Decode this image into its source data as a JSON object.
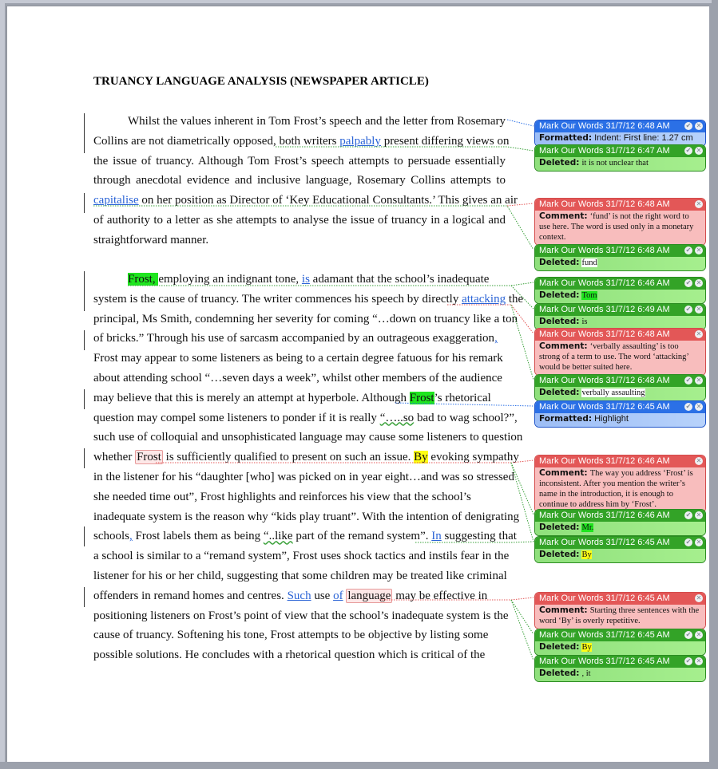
{
  "document": {
    "title": "TRUANCY LANGUAGE ANALYSIS (NEWSPAPER ARTICLE)",
    "paragraph1": [
      {
        "segments": [
          {
            "t": "Whilst the values inherent in Tom Frost’s speech and the letter from Rosemary"
          }
        ]
      },
      {
        "segments": [
          {
            "t": "Collins are not diametrically opposed, both writers "
          },
          {
            "t": "palpably",
            "s": "ins"
          },
          {
            "t": " present differing views on"
          }
        ]
      },
      {
        "segments": [
          {
            "t": "the issue of truancy. Although Tom Frost’s speech attempts to persuade essentially"
          }
        ]
      },
      {
        "segments": [
          {
            "t": "through anecdotal evidence and inclusive language, Rosemary Collins attempts to"
          }
        ]
      },
      {
        "segments": [
          {
            "t": "capitalise",
            "s": "ins"
          },
          {
            "t": " on her position as Director of ‘Key Educational Consultants.’ This gives an air"
          }
        ]
      },
      {
        "segments": [
          {
            "t": "of authority to a letter as she attempts to analyse the issue of truancy in a logical and"
          }
        ]
      },
      {
        "segments": [
          {
            "t": "straightforward manner."
          }
        ]
      }
    ],
    "paragraph2": [
      {
        "segments": [
          {
            "t": "Frost",
            "s": "hl-green"
          },
          {
            "t": ", ",
            "s": "hl-green"
          },
          {
            "t": "employing an indignant tone, "
          },
          {
            "t": "is",
            "s": "ins"
          },
          {
            "t": " adamant that the school’s inadequate"
          }
        ]
      },
      {
        "segments": [
          {
            "t": "system is the cause of truancy. The writer commences his speech by directly "
          },
          {
            "t": "attacking",
            "s": "ins"
          },
          {
            "t": " the"
          }
        ]
      },
      {
        "segments": [
          {
            "t": "principal, Ms Smith, condemning her severity for coming “…down on truancy like a ton"
          }
        ]
      },
      {
        "segments": [
          {
            "t": "of bricks.” Through his use of sarcasm accompanied by an outrageous exaggeration"
          },
          {
            "t": ",",
            "s": "ins"
          }
        ]
      },
      {
        "segments": [
          {
            "t": "Frost may appear to some listeners as being to a certain degree fatuous for his remark"
          }
        ]
      },
      {
        "segments": [
          {
            "t": "about attending school “…seven days a week”, whilst other members of the audience"
          }
        ]
      },
      {
        "segments": [
          {
            "t": "may believe that this is merely an attempt at hyperbole. Although "
          },
          {
            "t": "Frost",
            "s": "hl-green"
          },
          {
            "t": "’s rhetorical"
          }
        ]
      },
      {
        "segments": [
          {
            "t": "question may compel some listeners to ponder if it is really "
          },
          {
            "t": "“…..so",
            "s": "squig"
          },
          {
            "t": " bad to wag school?”,"
          }
        ]
      },
      {
        "segments": [
          {
            "t": "such use of colloquial and unsophisticated language may cause some listeners to question"
          }
        ]
      },
      {
        "segments": [
          {
            "t": "whether "
          },
          {
            "t": "Frost",
            "s": "del-box"
          },
          {
            "t": " is sufficiently qualified to present on such an issue. "
          },
          {
            "t": "By",
            "s": "hl-yellow"
          },
          {
            "t": " evoking sympathy"
          }
        ]
      },
      {
        "segments": [
          {
            "t": "in the listener for his “daughter [who] was picked on in year eight…and was so stressed"
          }
        ]
      },
      {
        "segments": [
          {
            "t": "she needed time out”, Frost highlights and reinforces his view that the school’s"
          }
        ]
      },
      {
        "segments": [
          {
            "t": "inadequate system is the reason why “kids play truant”. With the intention of denigrating"
          }
        ]
      },
      {
        "segments": [
          {
            "t": "schools"
          },
          {
            "t": ",",
            "s": "ins"
          },
          {
            "t": " Frost labels them as being "
          },
          {
            "t": "“..like",
            "s": "squig"
          },
          {
            "t": " part of the remand system”. "
          },
          {
            "t": "In",
            "s": "ins"
          },
          {
            "t": " suggesting that"
          }
        ]
      },
      {
        "segments": [
          {
            "t": "a school is similar to a “remand system”, Frost uses shock tactics and instils fear in the"
          }
        ]
      },
      {
        "segments": [
          {
            "t": "listener for his or her child, suggesting that some children may be treated like criminal"
          }
        ]
      },
      {
        "segments": [
          {
            "t": "offenders in remand homes and centres. "
          },
          {
            "t": "Such",
            "s": "ins"
          },
          {
            "t": " use "
          },
          {
            "t": "of",
            "s": "ins"
          },
          {
            "t": " "
          },
          {
            "t": "language",
            "s": "del-box"
          },
          {
            "t": " may be effective in"
          }
        ]
      },
      {
        "segments": [
          {
            "t": "positioning listeners on Frost’s point of view that the school’s inadequate system is the"
          }
        ]
      },
      {
        "segments": [
          {
            "t": "cause of truancy. Softening his tone, Frost attempts to be objective by listing some"
          }
        ]
      },
      {
        "segments": [
          {
            "t": "possible solutions. He concludes with a rhetorical question which is critical of the"
          }
        ]
      }
    ]
  },
  "balloons": [
    {
      "type": "blue",
      "author": "Mark Our Words",
      "date": "31/7/12 6:48 AM",
      "label": "Formatted:",
      "text": "Indent: First line:  1.27 cm",
      "sans": true,
      "accept": true
    },
    {
      "type": "green",
      "author": "Mark Our Words",
      "date": "31/7/12 6:47 AM",
      "label": "Deleted:",
      "text": "it is not unclear that",
      "accept": true
    },
    {
      "type": "red",
      "author": "Mark Our Words",
      "date": "31/7/12 6:48 AM",
      "label": "Comment:",
      "text": "‘fund’ is not the right word to use here. The word is used only in a monetary context.",
      "accept": false
    },
    {
      "type": "green",
      "author": "Mark Our Words",
      "date": "31/7/12 6:48 AM",
      "label": "Deleted:",
      "text": "fund",
      "accept": true
    },
    {
      "type": "green",
      "author": "Mark Our Words",
      "date": "31/7/12 6:46 AM",
      "label": "Deleted:",
      "text": "Tom",
      "highlight": "green",
      "accept": true
    },
    {
      "type": "green",
      "author": "Mark Our Words",
      "date": "31/7/12 6:49 AM",
      "label": "Deleted:",
      "text": "is",
      "accept": true
    },
    {
      "type": "red",
      "author": "Mark Our Words",
      "date": "31/7/12 6:48 AM",
      "label": "Comment:",
      "text": "‘verbally assaulting’ is too strong of a term to use. The word ‘attacking’ would be better suited here.",
      "accept": false
    },
    {
      "type": "green",
      "author": "Mark Our Words",
      "date": "31/7/12 6:48 AM",
      "label": "Deleted:",
      "text": "verbally assaulting",
      "accept": true
    },
    {
      "type": "blue",
      "author": "Mark Our Words",
      "date": "31/7/12 6:45 AM",
      "label": "Formatted:",
      "text": "Highlight",
      "sans": true,
      "accept": true
    },
    {
      "type": "red",
      "author": "Mark Our Words",
      "date": "31/7/12 6:46 AM",
      "label": "Comment:",
      "text": "The way you address ‘Frost’ is inconsistent. After you mention the writer’s name in the introduction, it is enough to continue to address him by ‘Frost’.",
      "accept": false
    },
    {
      "type": "green",
      "author": "Mark Our Words",
      "date": "31/7/12 6:46 AM",
      "label": "Deleted:",
      "text": "Mr.",
      "highlight": "green",
      "accept": true
    },
    {
      "type": "green",
      "author": "Mark Our Words",
      "date": "31/7/12 6:45 AM",
      "label": "Deleted:",
      "text": "By",
      "highlight": "yellow",
      "accept": true
    },
    {
      "type": "red",
      "author": "Mark Our Words",
      "date": "31/7/12 6:45 AM",
      "label": "Comment:",
      "text": "Starting three sentences with the word ‘By’ is overly repetitive.",
      "accept": false
    },
    {
      "type": "green",
      "author": "Mark Our Words",
      "date": "31/7/12 6:45 AM",
      "label": "Deleted:",
      "text": "By",
      "highlight": "yellow",
      "accept": true
    },
    {
      "type": "green",
      "author": "Mark Our Words",
      "date": "31/7/12 6:45 AM",
      "label": "Deleted:",
      "text": ", it",
      "accept": true
    }
  ],
  "icons": {
    "accept": "checkmark-icon",
    "reject": "close-icon"
  },
  "colors": {
    "insert": "#2b64d6",
    "green_balloon": "#33a327",
    "blue_balloon": "#2b70e6",
    "red_balloon": "#e35757",
    "highlight_green": "#1fe51f",
    "highlight_yellow": "#ffff14"
  }
}
